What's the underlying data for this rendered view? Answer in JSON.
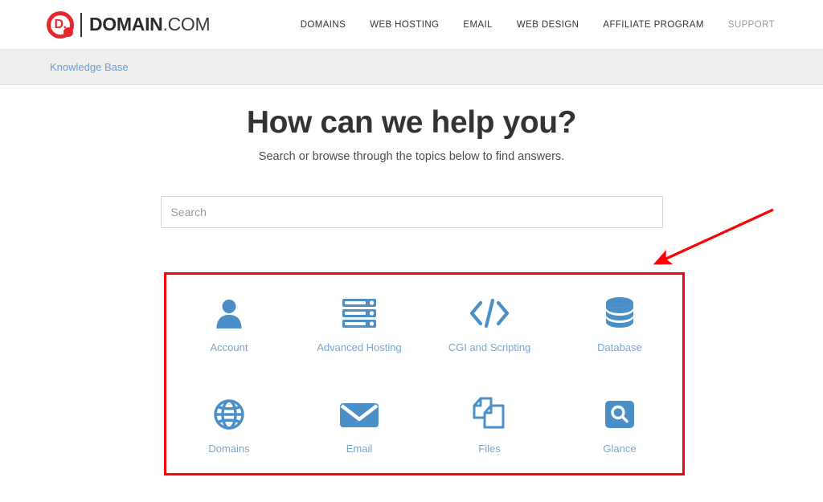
{
  "header": {
    "logo": {
      "mark_letter": "D.",
      "brand_bold": "DOMAIN",
      "brand_light": ".COM",
      "mark_color": "#e8262c"
    },
    "nav": [
      {
        "label": "DOMAINS",
        "muted": false
      },
      {
        "label": "WEB HOSTING",
        "muted": false
      },
      {
        "label": "EMAIL",
        "muted": false
      },
      {
        "label": "WEB DESIGN",
        "muted": false
      },
      {
        "label": "AFFILIATE PROGRAM",
        "muted": false
      },
      {
        "label": "SUPPORT",
        "muted": true
      }
    ]
  },
  "breadcrumb": {
    "label": "Knowledge Base",
    "link_color": "#6c9bd2",
    "bar_color": "#eeeeee"
  },
  "hero": {
    "title": "How can we help you?",
    "subtitle": "Search or browse through the topics below to find answers."
  },
  "search": {
    "placeholder": "Search",
    "value": ""
  },
  "topics": {
    "accent_color": "#4b8fc9",
    "label_color": "#7ea4ca",
    "items": [
      {
        "label": "Account",
        "icon": "user-icon"
      },
      {
        "label": "Advanced Hosting",
        "icon": "server-rack-icon"
      },
      {
        "label": "CGI and Scripting",
        "icon": "code-brackets-icon"
      },
      {
        "label": "Database",
        "icon": "database-icon"
      },
      {
        "label": "Domains",
        "icon": "globe-icon"
      },
      {
        "label": "Email",
        "icon": "envelope-icon"
      },
      {
        "label": "Files",
        "icon": "documents-icon"
      },
      {
        "label": "Glance",
        "icon": "magnifier-square-icon"
      }
    ]
  },
  "annotation": {
    "box_color": "#fb0007",
    "arrow_color": "#fb0007"
  }
}
